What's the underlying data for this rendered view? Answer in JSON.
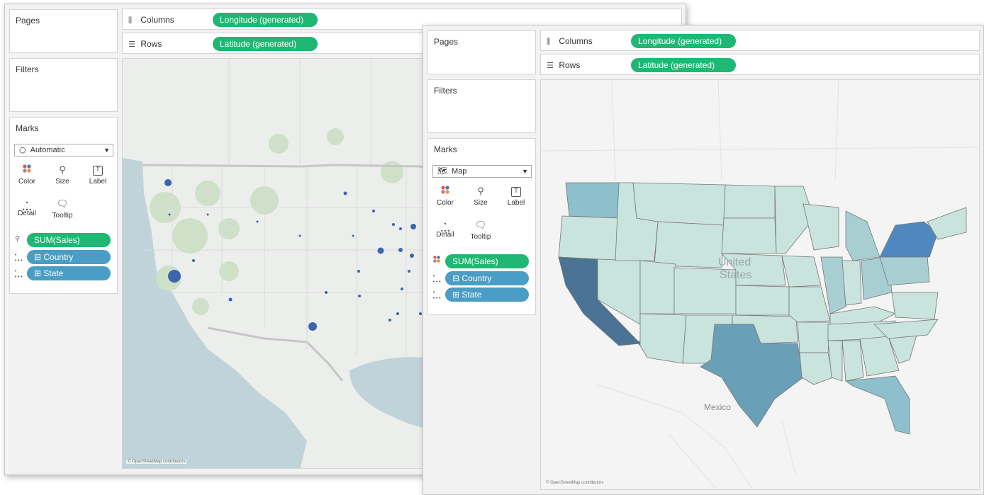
{
  "window1": {
    "pages_label": "Pages",
    "filters_label": "Filters",
    "marks_label": "Marks",
    "columns_label": "Columns",
    "rows_label": "Rows",
    "columns_pill": "Longitude (generated)",
    "rows_pill": "Latitude (generated)",
    "mark_type": "Automatic",
    "mark_type_icon": "circle-icon",
    "buttons": {
      "color": "Color",
      "size": "Size",
      "label": "Label",
      "detail": "Detail",
      "tooltip": "Tooltip"
    },
    "marks_pills": [
      {
        "text": "SUM(Sales)",
        "icon": "size-icon"
      },
      {
        "text": "⊟ Country",
        "icon": "detail-icon"
      },
      {
        "text": "⊞ State",
        "icon": "detail-icon"
      }
    ],
    "map_attribution": "© OpenStreetMap contributors"
  },
  "window2": {
    "pages_label": "Pages",
    "filters_label": "Filters",
    "marks_label": "Marks",
    "columns_label": "Columns",
    "rows_label": "Rows",
    "columns_pill": "Longitude (generated)",
    "rows_pill": "Latitude (generated)",
    "mark_type": "Map",
    "mark_type_icon": "map-icon",
    "buttons": {
      "color": "Color",
      "size": "Size",
      "label": "Label",
      "detail": "Detail",
      "tooltip": "Tooltip"
    },
    "marks_pills": [
      {
        "text": "SUM(Sales)",
        "icon": "color-icon"
      },
      {
        "text": "⊟ Country",
        "icon": "detail-icon"
      },
      {
        "text": "⊞ State",
        "icon": "detail-icon"
      }
    ],
    "map_labels": {
      "country_us_line1": "United",
      "country_us_line2": "States",
      "mexico": "Mexico"
    },
    "map_attribution": "© OpenStreetMap contributors"
  },
  "colors": {
    "pill_green": "#1fb774",
    "pill_blue": "#4a9dc4",
    "symbol_blue": "#3b66ae",
    "state_light": "#c9e3dd",
    "state_dark": "#4a7396"
  }
}
